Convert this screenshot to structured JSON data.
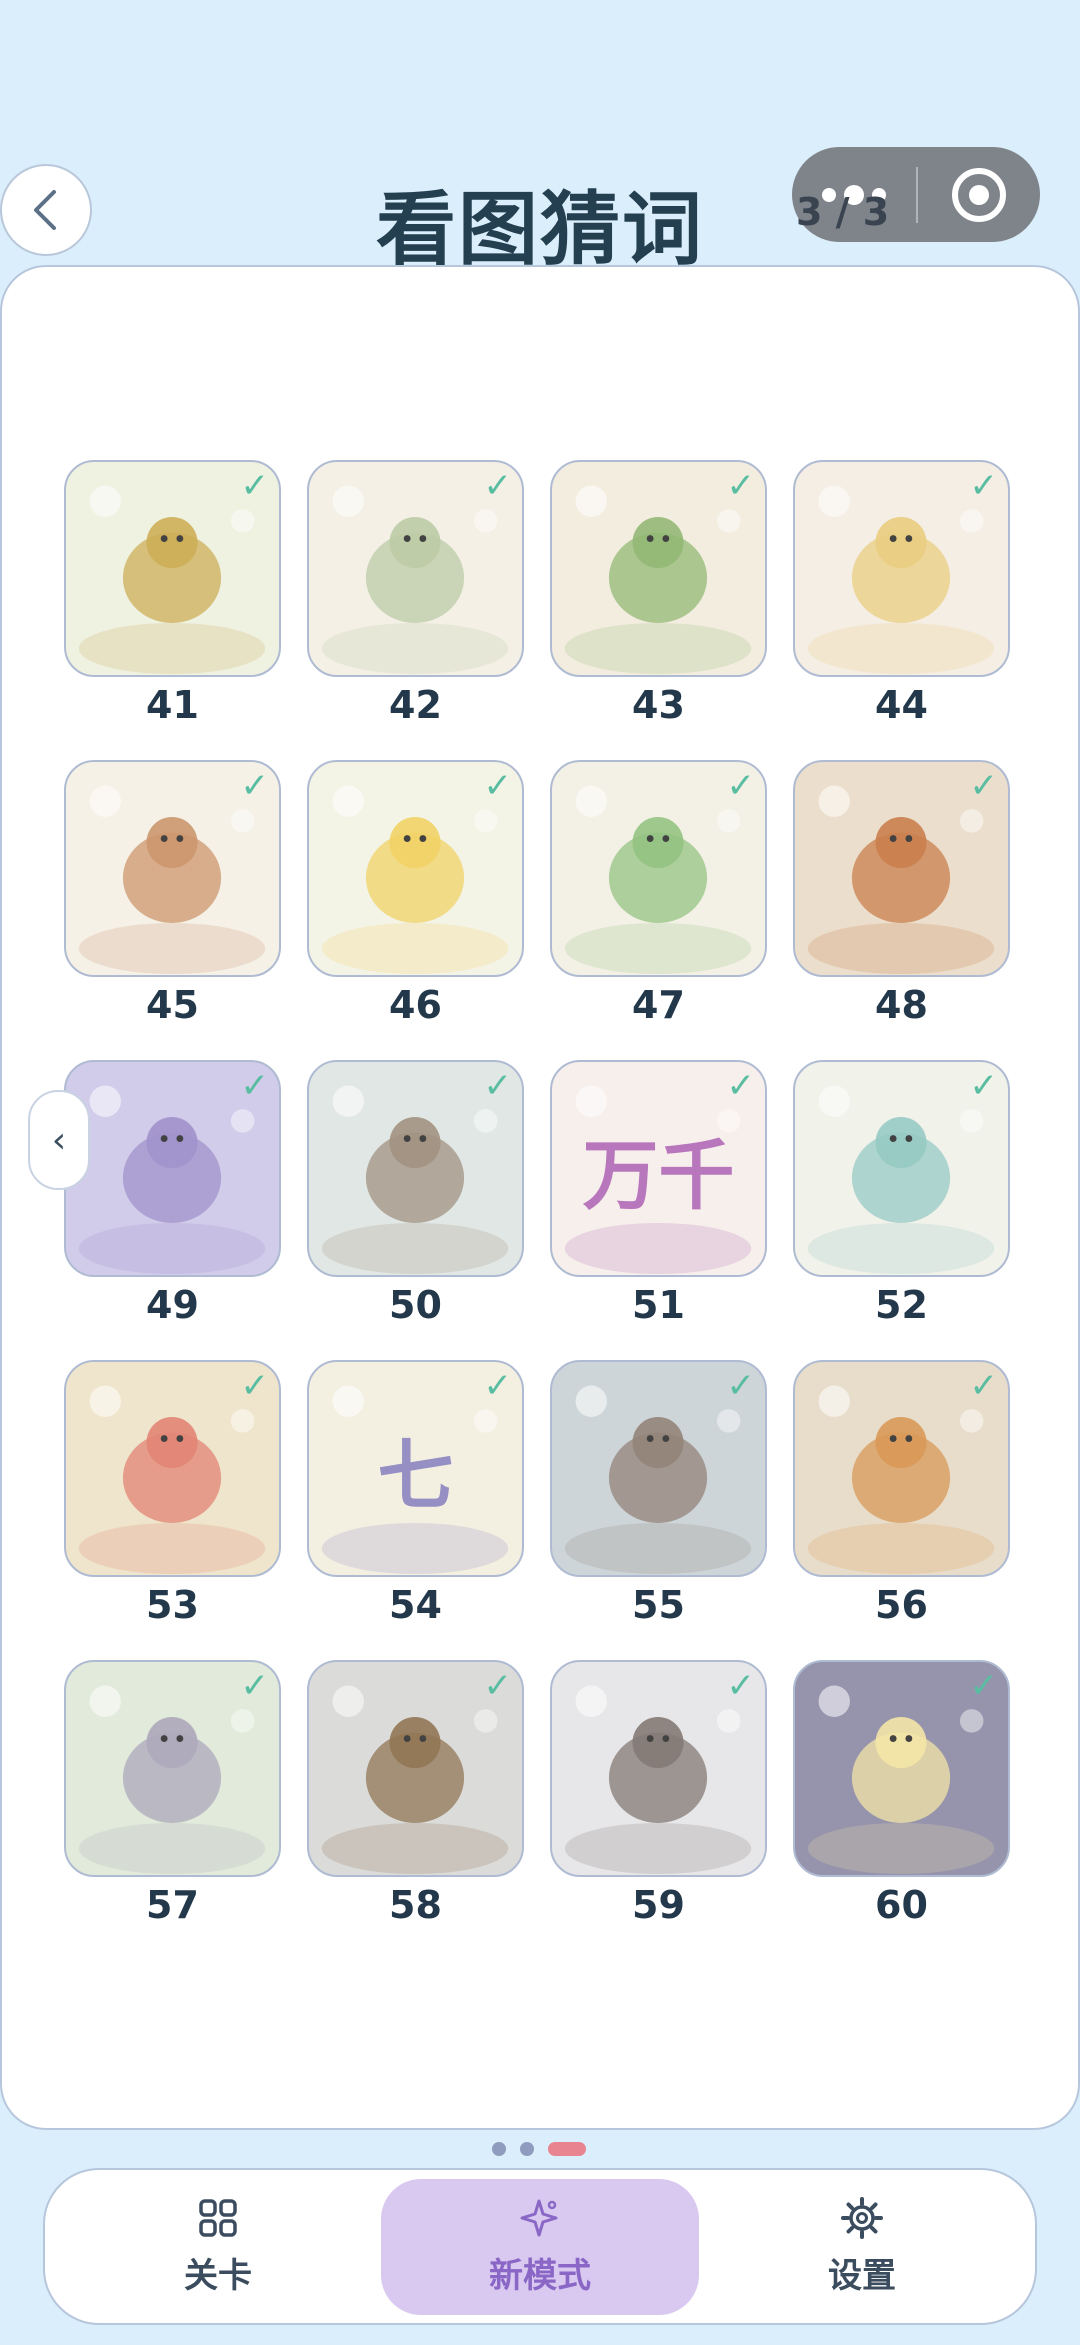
{
  "header": {
    "title": "看图猜词",
    "page_indicator": "3 / 3"
  },
  "levels": [
    {
      "num": "41",
      "icon": "snakes-icon",
      "bg": "#eef0df",
      "accent": "#c9a84a",
      "done": true
    },
    {
      "num": "42",
      "icon": "boy-sword-icon",
      "bg": "#f4efe4",
      "accent": "#b7c8a0",
      "done": true
    },
    {
      "num": "43",
      "icon": "cucumber-knife-icon",
      "bg": "#f3ecde",
      "accent": "#8bb46a",
      "done": true
    },
    {
      "num": "44",
      "icon": "boy-pancake-icon",
      "bg": "#f4ede2",
      "accent": "#e9c977",
      "done": true
    },
    {
      "num": "45",
      "icon": "cow-horse-icon",
      "bg": "#f5f0e6",
      "accent": "#c98f62",
      "done": true
    },
    {
      "num": "46",
      "icon": "bee-calendar-icon",
      "bg": "#f3f2e4",
      "accent": "#f0cf5a",
      "done": true
    },
    {
      "num": "47",
      "icon": "crocodiles-icon",
      "bg": "#f3efe3",
      "accent": "#8cbf78",
      "done": true
    },
    {
      "num": "48",
      "icon": "monkey-king-icon",
      "bg": "#eadcc8",
      "accent": "#c5763f",
      "done": true
    },
    {
      "num": "49",
      "icon": "magpie-bridge-icon",
      "bg": "#cdc8e8",
      "accent": "#9a8ac8",
      "done": true
    },
    {
      "num": "50",
      "icon": "giant-icon",
      "bg": "#dfe6e2",
      "accent": "#9a8a78",
      "done": true
    },
    {
      "num": "51",
      "icon": "wanqian-text-icon",
      "bg": "#f7eeea",
      "accent": "#b36bb8",
      "done": true,
      "glyph_text": "万千"
    },
    {
      "num": "52",
      "icon": "ice-dragon-icon",
      "bg": "#f0f1e8",
      "accent": "#8fc5c0",
      "done": true
    },
    {
      "num": "53",
      "icon": "flower-embroidery-icon",
      "bg": "#eee3c8",
      "accent": "#e07a6a",
      "done": true
    },
    {
      "num": "54",
      "icon": "scale-icon",
      "bg": "#f3efe0",
      "accent": "#8d86c0",
      "done": true,
      "glyph_text": "七"
    },
    {
      "num": "55",
      "icon": "rain-bowl-icon",
      "bg": "#c9d2d6",
      "accent": "#8b7a6e",
      "done": true
    },
    {
      "num": "56",
      "icon": "tiger-fox-icon",
      "bg": "#e7dbc6",
      "accent": "#d6904a",
      "done": true
    },
    {
      "num": "57",
      "icon": "blind-elephant-icon",
      "bg": "#dfe9d8",
      "accent": "#a7a1b6",
      "done": true
    },
    {
      "num": "58",
      "icon": "straw-boat-icon",
      "bg": "#d8d8d6",
      "accent": "#8a6b48",
      "done": true
    },
    {
      "num": "59",
      "icon": "snow-charcoal-icon",
      "bg": "#e6e6e8",
      "accent": "#7a6f6a",
      "done": true
    },
    {
      "num": "60",
      "icon": "light-wall-icon",
      "bg": "#8e8ba6",
      "accent": "#f3e3a0",
      "done": true
    }
  ],
  "check_mark": "✓",
  "side_arrow": "‹",
  "tabs": [
    {
      "label": "关卡",
      "icon": "grid-icon",
      "active": false
    },
    {
      "label": "新模式",
      "icon": "sparkle-icon",
      "active": true
    },
    {
      "label": "设置",
      "icon": "gear-icon",
      "active": false
    }
  ],
  "colors": {
    "background": "#dbeefb",
    "title": "#233f50",
    "check": "#4cb89a",
    "active_tab": "#d9c9f0",
    "pager_active": "#e8848f"
  }
}
